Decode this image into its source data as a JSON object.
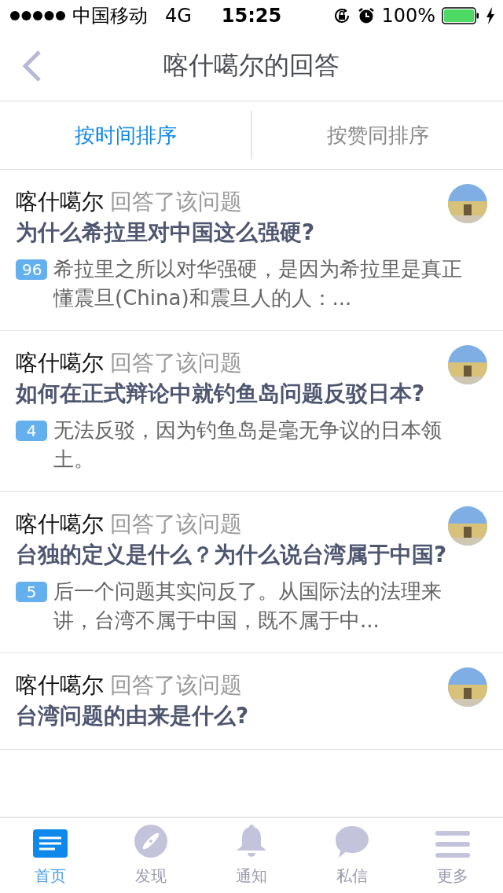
{
  "status_bar": {
    "carrier": "中国移动",
    "network": "4G",
    "time": "15:25",
    "battery": "100%"
  },
  "nav": {
    "title": "喀什噶尔的回答"
  },
  "sort_tabs": [
    {
      "label": "按时间排序",
      "selected": true
    },
    {
      "label": "按赞同排序",
      "selected": false
    }
  ],
  "answers": [
    {
      "author": "喀什噶尔",
      "action": "回答了该问题",
      "question": "为什么希拉里对中国这么强硬?",
      "votes": "96",
      "excerpt": "希拉里之所以对华强硬，是因为希拉里是真正懂震旦(China)和震旦人的人：..."
    },
    {
      "author": "喀什噶尔",
      "action": "回答了该问题",
      "question": "如何在正式辩论中就钓鱼岛问题反驳日本?",
      "votes": "4",
      "excerpt": "无法反驳，因为钓鱼岛是毫无争议的日本领土。"
    },
    {
      "author": "喀什噶尔",
      "action": "回答了该问题",
      "question": "台独的定义是什么？为什么说台湾属于中国?",
      "votes": "5",
      "excerpt": "后一个问题其实问反了。从国际法的法理来讲，台湾不属于中国，既不属于中..."
    },
    {
      "author": "喀什噶尔",
      "action": "回答了该问题",
      "question": "台湾问题的由来是什么?"
    }
  ],
  "tab_bar": [
    {
      "label": "首页",
      "kind": "home",
      "selected": true
    },
    {
      "label": "发现",
      "kind": "discover",
      "selected": false
    },
    {
      "label": "通知",
      "kind": "notify",
      "selected": false
    },
    {
      "label": "私信",
      "kind": "message",
      "selected": false
    },
    {
      "label": "更多",
      "kind": "more",
      "selected": false
    }
  ]
}
